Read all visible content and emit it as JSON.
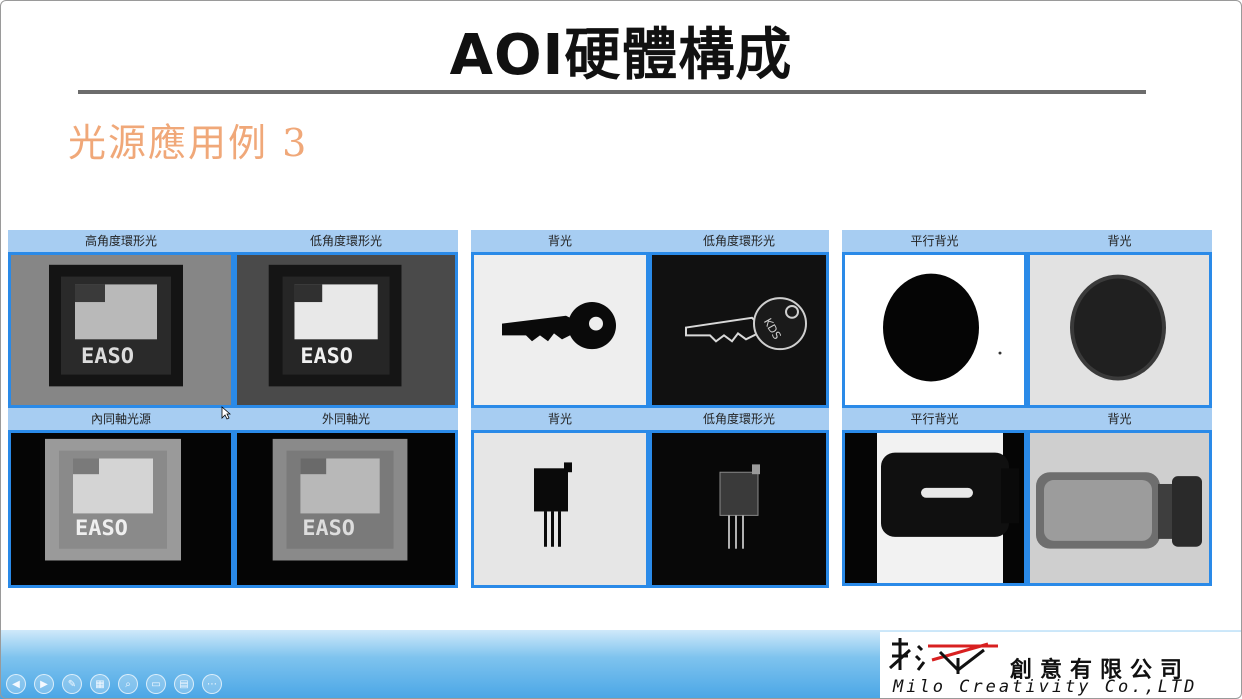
{
  "slide": {
    "title": "AOI硬體構成",
    "subtitle": "光源應用例 3"
  },
  "panels": [
    {
      "cells": [
        {
          "label": "高角度環形光",
          "image": "chip-high-angle-ring"
        },
        {
          "label": "低角度環形光",
          "image": "chip-low-angle-ring"
        },
        {
          "label": "內同軸光源",
          "image": "chip-coaxial-inner"
        },
        {
          "label": "外同軸光",
          "image": "chip-coaxial-outer"
        }
      ]
    },
    {
      "cells": [
        {
          "label": "背光",
          "image": "key-silhouette"
        },
        {
          "label": "低角度環形光",
          "image": "key-low-angle"
        },
        {
          "label": "背光",
          "image": "potentiometer-silhouette"
        },
        {
          "label": "低角度環形光",
          "image": "potentiometer-low-angle"
        }
      ]
    },
    {
      "cells": [
        {
          "label": "平行背光",
          "image": "disc-parallel-backlight"
        },
        {
          "label": "背光",
          "image": "disc-backlight"
        },
        {
          "label": "平行背光",
          "image": "bottle-parallel-backlight"
        },
        {
          "label": "背光",
          "image": "bottle-backlight"
        }
      ]
    }
  ],
  "footer": {
    "company_cn": "創意有限公司",
    "company_en": "Milo Creativity Co.,LTD"
  },
  "nav_icons": [
    "prev-icon",
    "next-icon",
    "pen-icon",
    "slides-icon",
    "zoom-icon",
    "view-icon",
    "subtitle-icon",
    "more-icon"
  ],
  "nav_glyphs": [
    "◀",
    "▶",
    "✎",
    "▦",
    "⌕",
    "▭",
    "▤",
    "⋯"
  ],
  "colors": {
    "header_blue": "#a7cdf2",
    "border_blue": "#2a8ae8",
    "subtitle_orange": "#f0a879"
  }
}
